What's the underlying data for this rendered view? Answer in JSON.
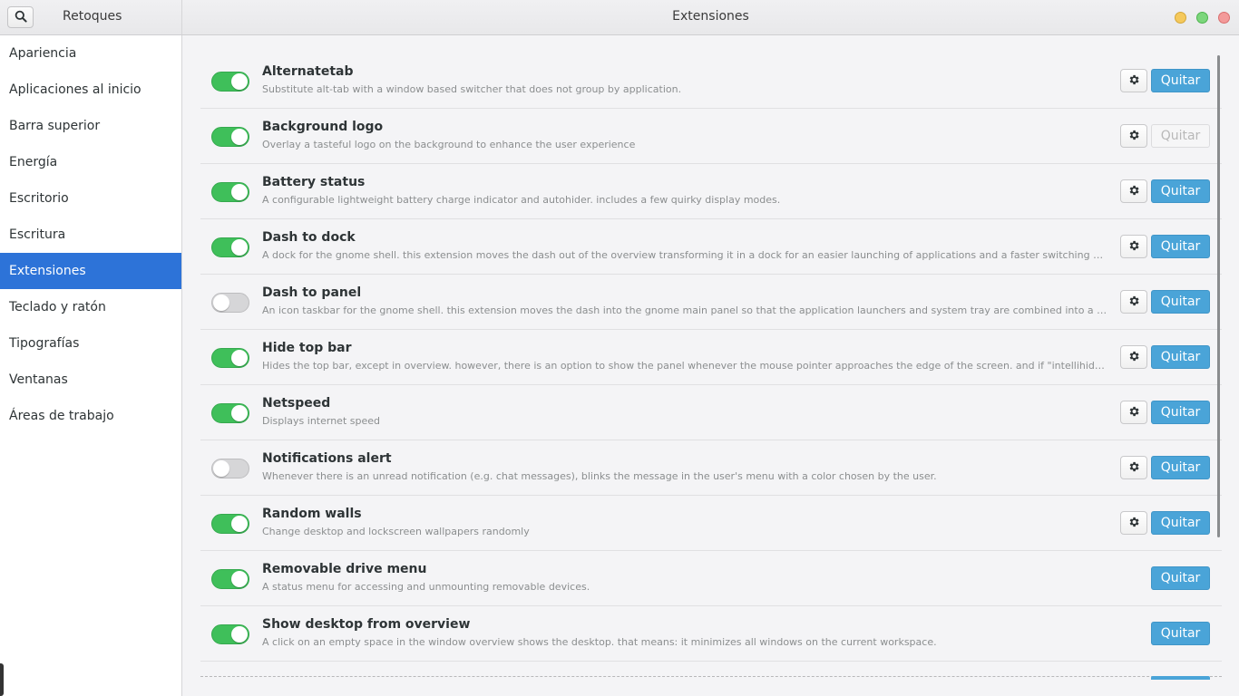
{
  "headerbar": {
    "left_title": "Retoques",
    "title": "Extensiones"
  },
  "sidebar": {
    "items": [
      {
        "label": "Apariencia",
        "active": false
      },
      {
        "label": "Aplicaciones al inicio",
        "active": false
      },
      {
        "label": "Barra superior",
        "active": false
      },
      {
        "label": "Energía",
        "active": false
      },
      {
        "label": "Escritorio",
        "active": false
      },
      {
        "label": "Escritura",
        "active": false
      },
      {
        "label": "Extensiones",
        "active": true
      },
      {
        "label": "Teclado y ratón",
        "active": false
      },
      {
        "label": "Tipografías",
        "active": false
      },
      {
        "label": "Ventanas",
        "active": false
      },
      {
        "label": "Áreas de trabajo",
        "active": false
      }
    ]
  },
  "extensions": [
    {
      "name": "Alternatetab",
      "description": "Substitute alt-tab with a window based switcher that does not group by application.",
      "enabled": true,
      "has_settings": true,
      "remove_label": "Quitar",
      "remove_enabled": true
    },
    {
      "name": "Background logo",
      "description": "Overlay a tasteful logo on the background to enhance the user experience",
      "enabled": true,
      "has_settings": true,
      "remove_label": "Quitar",
      "remove_enabled": false
    },
    {
      "name": "Battery status",
      "description": "A configurable lightweight battery charge indicator and autohider. includes a few quirky display modes.",
      "enabled": true,
      "has_settings": true,
      "remove_label": "Quitar",
      "remove_enabled": true
    },
    {
      "name": "Dash to dock",
      "description": "A dock for the gnome shell. this extension moves the dash out of the overview transforming it in a dock for an easier launching of applications and a faster switching between windows and desktops.",
      "enabled": true,
      "has_settings": true,
      "remove_label": "Quitar",
      "remove_enabled": true
    },
    {
      "name": "Dash to panel",
      "description": "An icon taskbar for the gnome shell. this extension moves the dash into the gnome main panel so that the application launchers and system tray are combined into a single panel.",
      "enabled": false,
      "has_settings": true,
      "remove_label": "Quitar",
      "remove_enabled": true
    },
    {
      "name": "Hide top bar",
      "description": "Hides the top bar, except in overview. however, there is an option to show the panel whenever the mouse pointer approaches the edge of the screen. and if \"intellihide\" is enabled, the panel only hides when a window takes the space.",
      "enabled": true,
      "has_settings": true,
      "remove_label": "Quitar",
      "remove_enabled": true
    },
    {
      "name": "Netspeed",
      "description": "Displays internet speed",
      "enabled": true,
      "has_settings": true,
      "remove_label": "Quitar",
      "remove_enabled": true
    },
    {
      "name": "Notifications alert",
      "description": "Whenever there is an unread notification (e.g. chat messages), blinks the message in the user's menu with a color chosen by the user.",
      "enabled": false,
      "has_settings": true,
      "remove_label": "Quitar",
      "remove_enabled": true
    },
    {
      "name": "Random walls",
      "description": "Change desktop and lockscreen wallpapers randomly",
      "enabled": true,
      "has_settings": true,
      "remove_label": "Quitar",
      "remove_enabled": true
    },
    {
      "name": "Removable drive menu",
      "description": "A status menu for accessing and unmounting removable devices.",
      "enabled": true,
      "has_settings": false,
      "remove_label": "Quitar",
      "remove_enabled": true
    },
    {
      "name": "Show desktop from overview",
      "description": "A click on an empty space in the window overview shows the desktop. that means: it minimizes all windows on the current workspace.",
      "enabled": true,
      "has_settings": false,
      "remove_label": "Quitar",
      "remove_enabled": true
    }
  ],
  "icons": {
    "search": "search-icon",
    "gear": "gear-icon"
  },
  "colors": {
    "accent": "#2d73d8",
    "toggle_on": "#3fbf5a",
    "remove_button": "#4aa4d8"
  }
}
